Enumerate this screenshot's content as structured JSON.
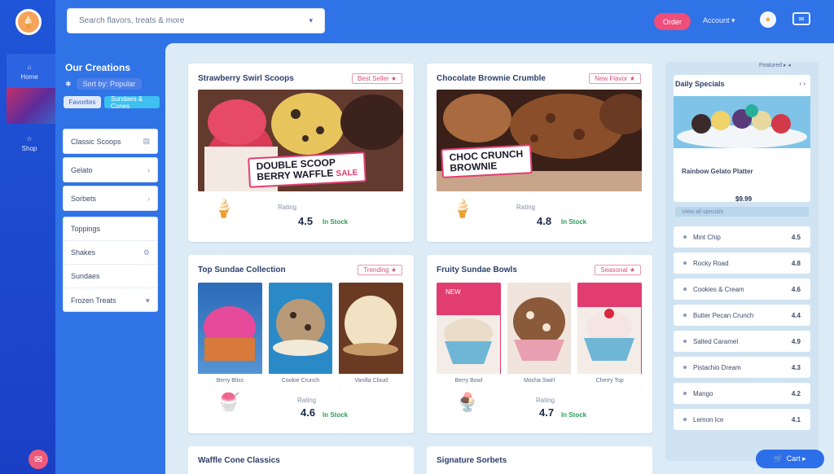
{
  "rail": {
    "items": [
      {
        "icon": "home-icon",
        "label": "Home"
      },
      {
        "icon": "star-icon",
        "label": "Shop"
      }
    ],
    "chat_icon": "chat-icon"
  },
  "topbar": {
    "search_placeholder": "Search flavors, treats & more",
    "action_button": "Order",
    "user_label": "Account ▾",
    "bell_icon": "bell-icon",
    "message_icon": "message-icon"
  },
  "filters": {
    "title": "Our Creations",
    "subtitle_tag": "Sort by: Popular",
    "chips": [
      "Favorites",
      "Sundaes & Cones"
    ],
    "group_one": [
      {
        "label": "Classic Scoops",
        "icon": "filter-icon"
      },
      {
        "label": "Gelato",
        "icon": "chevron-down-icon"
      },
      {
        "label": "Sorbets",
        "icon": "chevron-down-icon"
      }
    ],
    "group_two": [
      {
        "label": "Toppings",
        "icon": ""
      },
      {
        "label": "Shakes",
        "icon": "settings-icon"
      },
      {
        "label": "Sundaes",
        "icon": ""
      },
      {
        "label": "Frozen Treats",
        "icon": "heart-icon"
      }
    ]
  },
  "cards": [
    {
      "title": "Strawberry Swirl Scoops",
      "tag": "Best Seller ★",
      "banner_line1": "DOUBLE SCOOP",
      "banner_line2": "BERRY WAFFLE",
      "banner_sub": "SALE",
      "rating_label": "Rating",
      "score": "4.5",
      "green": "In Stock"
    },
    {
      "title": "Chocolate Brownie Crumble",
      "tag": "New Flavor ★",
      "banner_line1": "CHOC CRUNCH",
      "banner_line2": "BROWNIE",
      "banner_sub": "",
      "rating_label": "Rating",
      "score": "4.8",
      "green": "In Stock"
    },
    {
      "title": "Top Sundae Collection",
      "tag": "Trending ★",
      "tiles": [
        "Berry Bliss",
        "Cookie Crunch",
        "Vanilla Cloud"
      ],
      "rating_label": "Rating",
      "score": "4.6",
      "green": "In Stock"
    },
    {
      "title": "Fruity Sundae Bowls",
      "tag": "Seasonal ★",
      "tiles": [
        "Berry Bowl",
        "Mocha Swirl",
        "Cherry Top"
      ],
      "pin": "NEW",
      "rating_label": "Rating",
      "score": "4.7",
      "green": "In Stock"
    },
    {
      "title": "Waffle Cone Classics"
    },
    {
      "title": "Signature Sorbets"
    }
  ],
  "sidebar": {
    "header": "Featured ▸ ◂",
    "card_title": "Daily Specials",
    "card_arrows": "‹  ›",
    "card_name": "Rainbow Gelato Platter",
    "card_price": "$9.99",
    "strip": "View all specials",
    "list": [
      {
        "label": "Mint Chip",
        "value": "4.5"
      },
      {
        "label": "Rocky Road",
        "value": "4.8"
      },
      {
        "label": "Cookies & Cream",
        "value": "4.6"
      },
      {
        "label": "Butter Pecan Crunch",
        "value": "4.4"
      },
      {
        "label": "Salted Caramel",
        "value": "4.9"
      },
      {
        "label": "Pistachio Dream",
        "value": "4.3"
      },
      {
        "label": "Mango",
        "value": "4.2"
      },
      {
        "label": "Lemon Ice",
        "value": "4.1"
      }
    ],
    "fab": "Cart ▸"
  },
  "colors": {
    "accent": "#2f73e6",
    "pink": "#ef4d7a",
    "green": "#2e9e5a"
  }
}
